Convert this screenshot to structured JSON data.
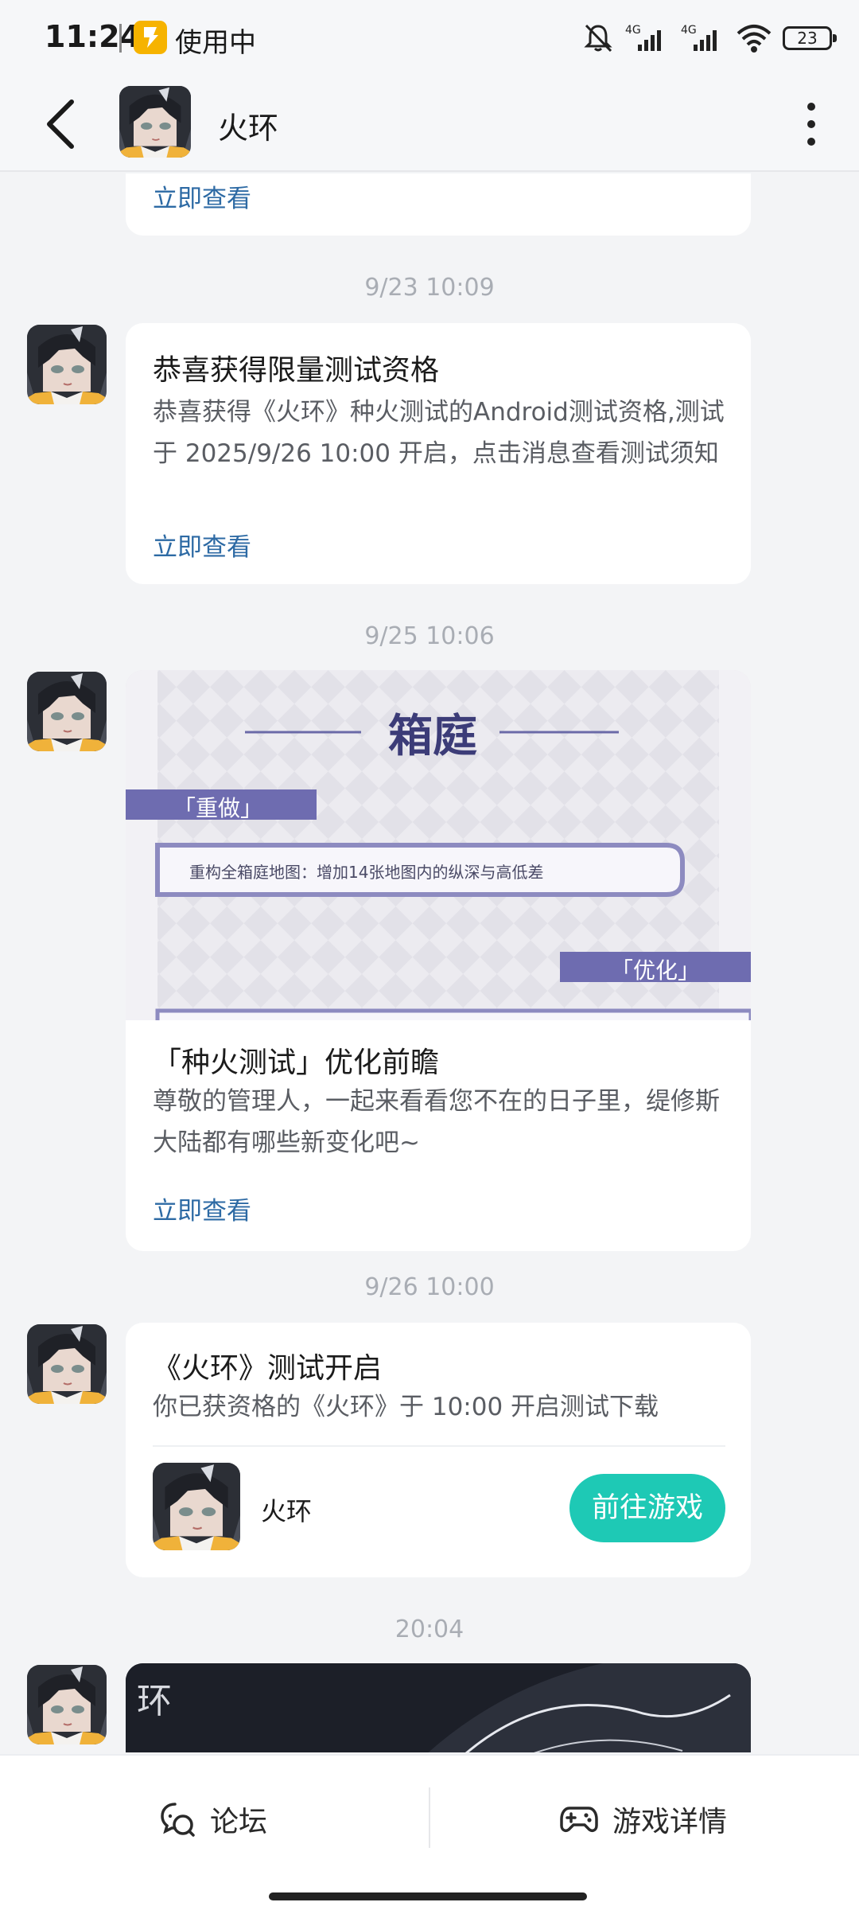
{
  "status_bar": {
    "time": "11:24",
    "in_use": "使用中",
    "battery": "23",
    "network_1": "4G",
    "network_2": "4G"
  },
  "header": {
    "title": "火环"
  },
  "messages": [
    {
      "link": "立即查看"
    },
    {
      "time": "9/23  10:09",
      "title": "恭喜获得限量测试资格",
      "body": "恭喜获得《火环》种火测试的Android测试资格,测试于 2025/9/26 10:00 开启，点击消息查看测试须知",
      "link": "立即查看"
    },
    {
      "time": "9/25  10:06",
      "banner": {
        "heading": "箱庭",
        "tag_left": "「重做」",
        "bullet": "重构全箱庭地图：增加14张地图内的纵深与高低差",
        "tag_right": "「优化」"
      },
      "title": "「种火测试」优化前瞻",
      "body": "尊敬的管理人，一起来看看您不在的日子里，缇修斯大陆都有哪些新变化吧~",
      "link": "立即查看"
    },
    {
      "time": "9/26  10:00",
      "title": "《火环》测试开启",
      "body": "你已获资格的《火环》于 10:00 开启测试下载",
      "game_name": "火环",
      "button": "前往游戏"
    },
    {
      "time": "20:04",
      "banner_text": "环"
    }
  ],
  "bottom_bar": {
    "forum": "论坛",
    "game_details": "游戏详情"
  },
  "colors": {
    "accent_button": "#1ec9b5",
    "link": "#2d6aa4",
    "flash_badge": "#f6b300"
  }
}
